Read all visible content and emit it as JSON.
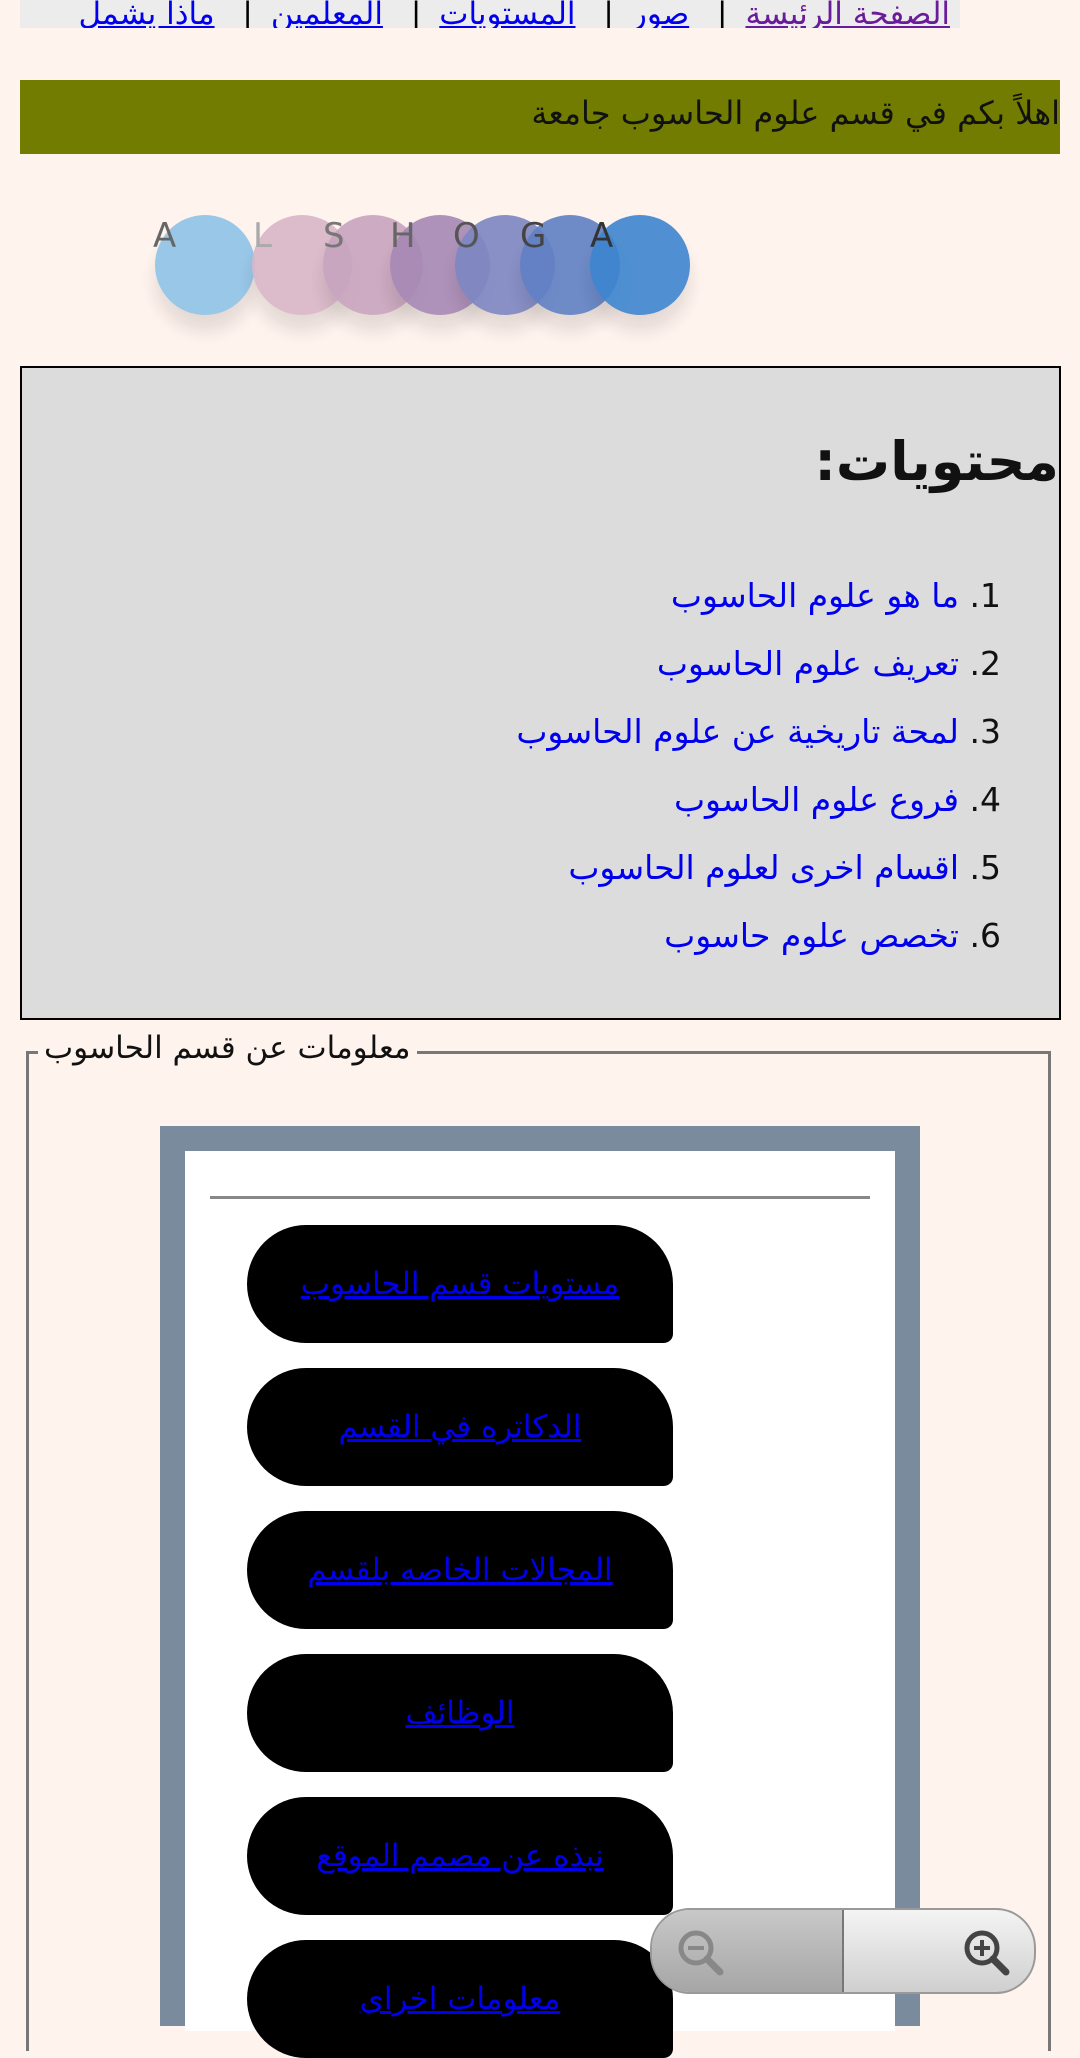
{
  "nav": {
    "items": [
      "الصفحة الرئيسة",
      "صور",
      "المستويات",
      "المعلمين",
      "ماذا يشمل"
    ],
    "separator": "|"
  },
  "banner": {
    "text": "اهلاً بكم في قسم علوم الحاسوب جامعة"
  },
  "logo": {
    "letters": [
      "A",
      "L",
      "S",
      "H",
      "O",
      "G",
      "A"
    ],
    "colors": [
      "#8fc3e8",
      "#d9b7c8",
      "#c8a4be",
      "#a788b5",
      "#7d86c2",
      "#5f80c4",
      "#3c85cf"
    ]
  },
  "contents": {
    "title": "محتويات:",
    "items": [
      {
        "num": "1.",
        "label": "ما هو علوم الحاسوب"
      },
      {
        "num": "2.",
        "label": "تعريف علوم الحاسوب"
      },
      {
        "num": "3.",
        "label": "لمحة تاريخية عن علوم الحاسوب"
      },
      {
        "num": "4.",
        "label": "فروع علوم الحاسوب"
      },
      {
        "num": "5.",
        "label": "اقسام اخرى لعلوم الحاسوب"
      },
      {
        "num": "6.",
        "label": "تخصص علوم حاسوب"
      }
    ]
  },
  "info": {
    "legend": "معلومات عن قسم الحاسوب",
    "buttons": [
      "مستويات قسم الحاسوب",
      "الدكاتره في القسم",
      "المجالات الخاصه بلقسم",
      "الوظائف",
      "نبذه عن مصمم الموقع",
      "معلومات اخراى"
    ]
  },
  "zoom": {
    "out_icon": "zoom-out-icon",
    "in_icon": "zoom-in-icon"
  }
}
